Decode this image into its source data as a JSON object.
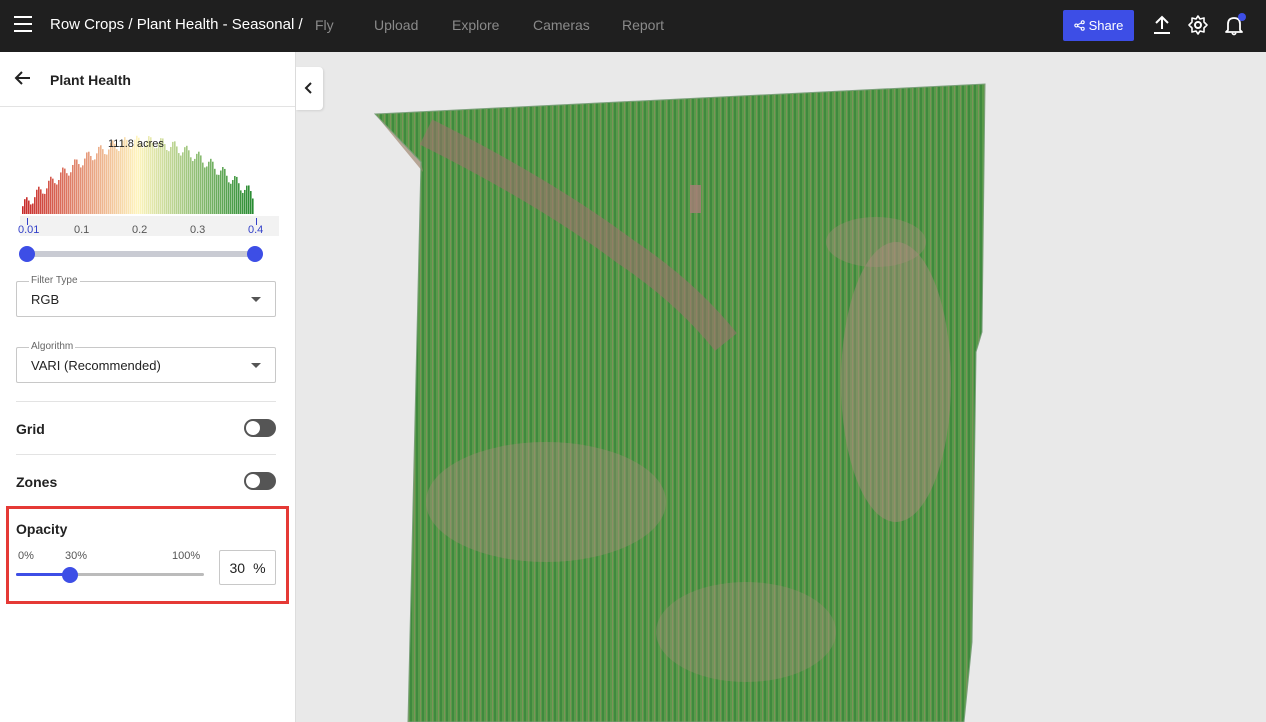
{
  "topbar": {
    "breadcrumb": "Row Crops / Plant Health - Seasonal /",
    "nav": [
      "Fly",
      "Upload",
      "Explore",
      "Cameras",
      "Report"
    ],
    "share_label": "Share"
  },
  "sidebar": {
    "title": "Plant Health",
    "histogram": {
      "area_label": "111.8 acres",
      "ticks": [
        "0.01",
        "0.1",
        "0.2",
        "0.3",
        "0.4"
      ],
      "range_min": 0.01,
      "range_max": 0.4
    },
    "filter_type": {
      "label": "Filter Type",
      "value": "RGB"
    },
    "algorithm": {
      "label": "Algorithm",
      "value": "VARI (Recommended)"
    },
    "grid": {
      "label": "Grid",
      "enabled": false
    },
    "zones": {
      "label": "Zones",
      "enabled": false
    },
    "opacity": {
      "label": "Opacity",
      "min_label": "0%",
      "value_label": "30%",
      "max_label": "100%",
      "value": "30",
      "unit": "%"
    }
  },
  "colors": {
    "accent": "#3d4ee6",
    "highlight": "#e53935",
    "topbar_bg": "#1f1f1f"
  },
  "icons": [
    "menu-icon",
    "arrow-left-icon",
    "chevron-left-icon",
    "share-icon",
    "upload-icon",
    "gear-icon",
    "bell-icon"
  ]
}
